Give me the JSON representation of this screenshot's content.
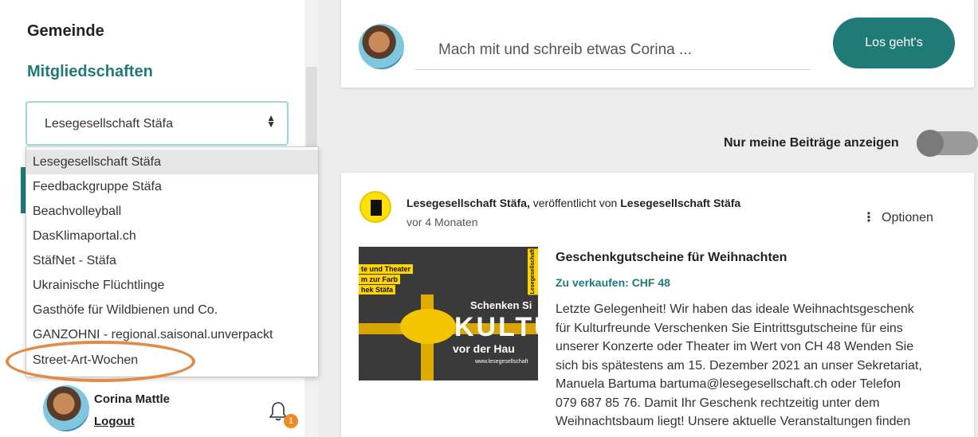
{
  "sidebar": {
    "section_title": "Gemeinde",
    "memberships_title": "Mitgliedschaften",
    "select_value": "Lesegesellschaft Stäfa",
    "dropdown_options": [
      "Lesegesellschaft Stäfa",
      "Feedbackgruppe Stäfa",
      "Beachvolleyball",
      "DasKlimaportal.ch",
      "StäfNet - Stäfa",
      "Ukrainische Flüchtlinge",
      "Gasthöfe für Wildbienen und Co.",
      "GANZOHNI - regional.saisonal.unverpackt",
      "Street-Art-Wochen"
    ],
    "user": {
      "name": "Corina Mattle",
      "logout_label": "Logout",
      "notification_count": "1"
    }
  },
  "composer": {
    "placeholder": "Mach mit und schreib etwas Corina ...",
    "button_label": "Los geht's"
  },
  "filter": {
    "toggle_label": "Nur meine Beiträge anzeigen",
    "enabled": false
  },
  "post": {
    "org_name": "Lesegesellschaft Stäfa,",
    "published_by_text": " veröffentlicht von ",
    "publisher": "Lesegesellschaft Stäfa",
    "time_ago": "vor 4 Monaten",
    "options_label": "Optionen",
    "title": "Geschenkgutscheine für Weihnachten",
    "price": "Zu verkaufen: CHF 48",
    "body_lines": [
      "Letzte Gelegenheit! Wir haben das ideale Weihnachtsgeschenk",
      "für Kulturfreunde Verschenken Sie Eintrittsgutscheine für eins",
      "unserer Konzerte oder Theater im Wert von CH 48 Wenden Sie",
      "sich bis spätestens am 15. Dezember 2021 an unser Sekretariat,",
      "Manuela Bartuma bartuma@lesegesellschaft.ch oder Telefon",
      "079 687 85 76. Damit Ihr Geschenk rechtzeitig unter dem",
      "Weihnachtsbaum liegt! Unsere aktuelle Veranstaltungen finden"
    ],
    "image": {
      "tag_1": "te und Theater",
      "tag_2": "m zur Farb",
      "tag_3": "hek Stäfa",
      "side_label": "Lesegesellschaft",
      "line_1": "Schenken Si",
      "line_2": "KULTU",
      "line_3": "vor der Hau",
      "line_4": "www.lesegesellschaft"
    }
  },
  "colors": {
    "accent": "#1f7a78",
    "highlight_ring": "#e28a48",
    "badge": "#f08a24"
  }
}
